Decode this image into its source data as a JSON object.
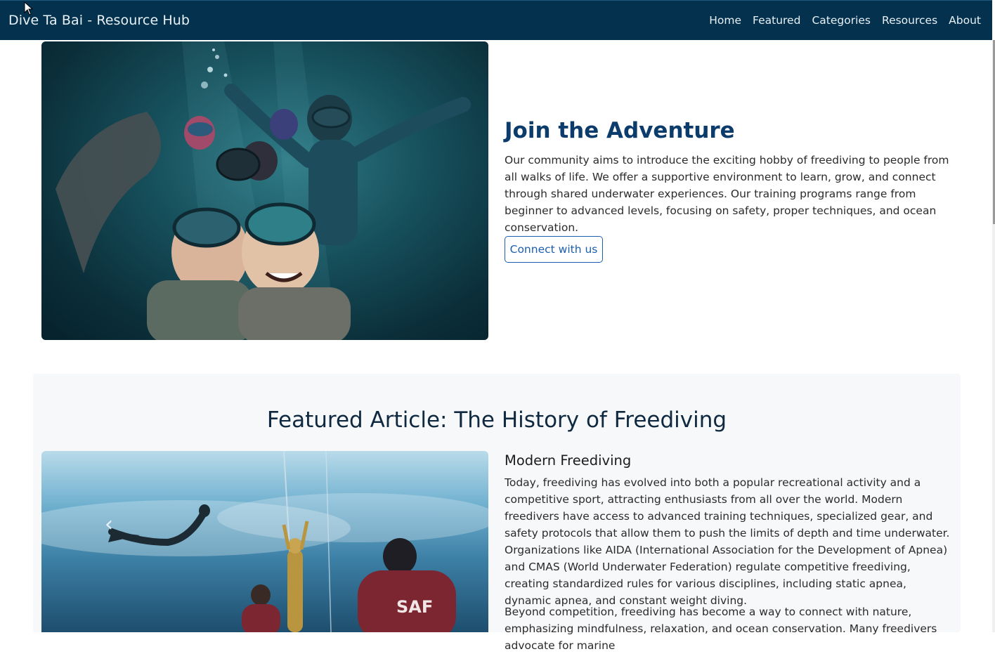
{
  "navbar": {
    "brand": "Dive Ta Bai - Resource Hub",
    "links": [
      "Home",
      "Featured",
      "Categories",
      "Resources",
      "About"
    ]
  },
  "join": {
    "title": "Join the Adventure",
    "text": "Our community aims to introduce the exciting hobby of freediving to people from all walks of life. We offer a supportive environment to learn, grow, and connect through shared underwater experiences. Our training programs range from beginner to advanced levels, focusing on safety, proper techniques, and ocean conservation.",
    "button_label": "Connect with us"
  },
  "featured": {
    "title": "Featured Article: The History of Freediving",
    "carousel": {
      "prev_icon": "chevron-left-icon",
      "next_icon": "chevron-right-icon"
    },
    "section_title": "Modern Freediving",
    "paragraph1": "Today, freediving has evolved into both a popular recreational activity and a competitive sport, attracting enthusiasts from all over the world. Modern freedivers have access to advanced training techniques, specialized gear, and safety protocols that allow them to push the limits of depth and time underwater. Organizations like AIDA (International Association for the Development of Apnea) and CMAS (World Underwater Federation) regulate competitive freediving, creating standardized rules for various disciplines, including static apnea, dynamic apnea, and constant weight diving.",
    "paragraph2": "Beyond competition, freediving has become a way to connect with nature, emphasizing mindfulness, relaxation, and ocean conservation. Many freedivers advocate for marine"
  },
  "colors": {
    "navbar": "#04324e",
    "accent": "#1b5fb0",
    "heading": "#0c3c6b"
  }
}
